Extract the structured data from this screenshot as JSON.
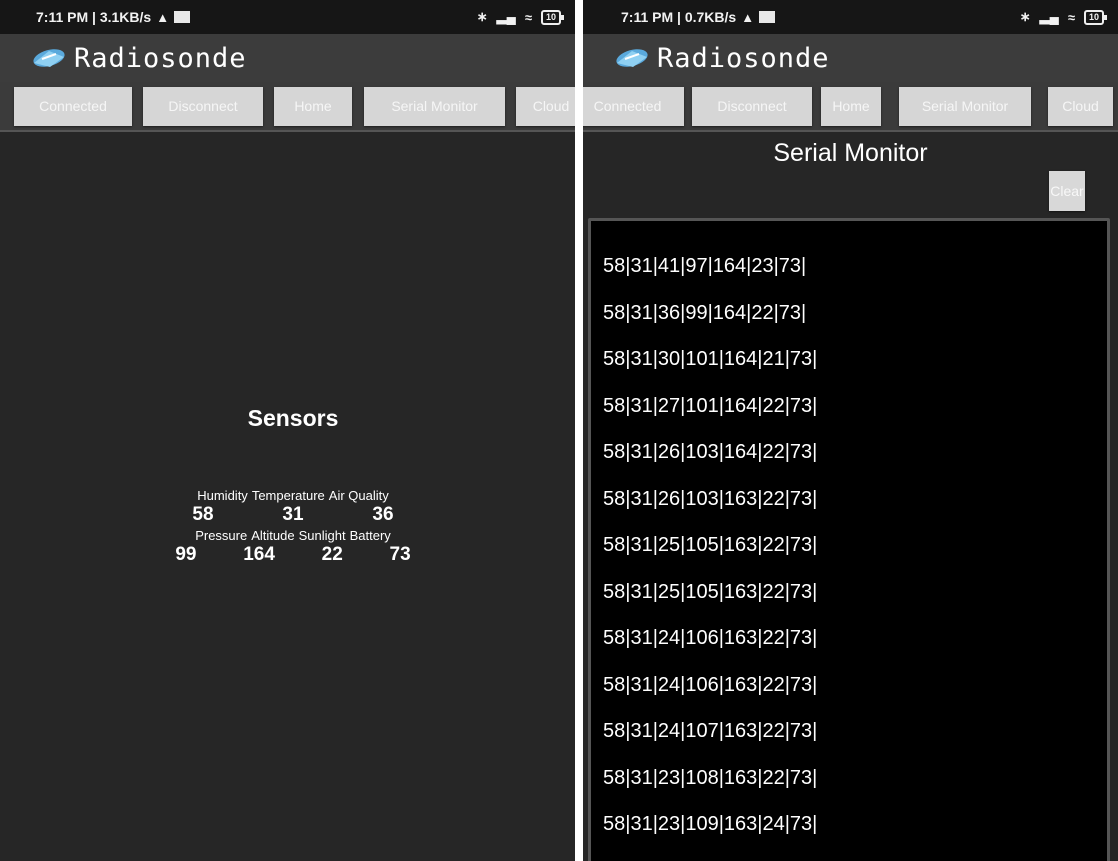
{
  "left": {
    "status": {
      "time": "7:11 PM | 3.1KB/s",
      "battery": "10"
    },
    "app_title": "Radiosonde",
    "tabs": [
      "Connected",
      "Disconnect",
      "Home",
      "Serial Monitor",
      "Cloud"
    ],
    "sensors": {
      "title": "Sensors",
      "row1_labels": [
        "Humidity",
        "Temperature",
        "Air Quality"
      ],
      "row1_values": [
        "58",
        "31",
        "36"
      ],
      "row2_labels": [
        "Pressure",
        "Altitude",
        "Sunlight",
        "Battery"
      ],
      "row2_values": [
        "99",
        "164",
        "22",
        "73"
      ]
    }
  },
  "right": {
    "status": {
      "time": "7:11 PM | 0.7KB/s",
      "battery": "10"
    },
    "app_title": "Radiosonde",
    "tabs": [
      "Connected",
      "Disconnect",
      "Home",
      "Serial Monitor",
      "Cloud"
    ],
    "serial_monitor": {
      "title": "Serial Monitor",
      "clear_label": "Clear",
      "lines": [
        "58|31|41|97|164|23|73|",
        "58|31|36|99|164|22|73|",
        "58|31|30|101|164|21|73|",
        "58|31|27|101|164|22|73|",
        "58|31|26|103|164|22|73|",
        "58|31|26|103|163|22|73|",
        "58|31|25|105|163|22|73|",
        "58|31|25|105|163|22|73|",
        "58|31|24|106|163|22|73|",
        "58|31|24|106|163|22|73|",
        "58|31|24|107|163|22|73|",
        "58|31|23|108|163|22|73|",
        "58|31|23|109|163|24|73|"
      ]
    }
  }
}
